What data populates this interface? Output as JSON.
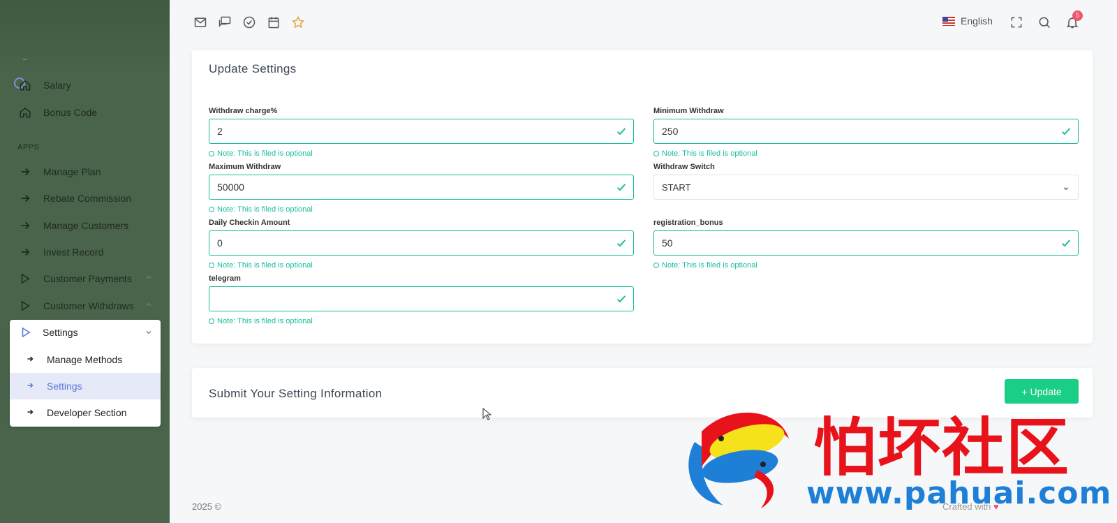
{
  "sidebar": {
    "items": [
      {
        "label": "Salary",
        "icon": "home-icon"
      },
      {
        "label": "Bonus Code",
        "icon": "home-icon"
      }
    ],
    "section_label": "APPS",
    "apps": [
      {
        "label": "Manage Plan",
        "icon": "arrow-right-icon"
      },
      {
        "label": "Rebate Commission",
        "icon": "arrow-right-icon"
      },
      {
        "label": "Manage Customers",
        "icon": "arrow-right-icon"
      },
      {
        "label": "Invest Record",
        "icon": "arrow-right-icon"
      },
      {
        "label": "Customer Payments",
        "icon": "play-icon"
      },
      {
        "label": "Customer Withdraws",
        "icon": "play-icon"
      }
    ],
    "settings_menu": {
      "label": "Settings",
      "items": [
        {
          "label": "Manage Methods",
          "active": false
        },
        {
          "label": "Settings",
          "active": true
        },
        {
          "label": "Developer Section",
          "active": false
        }
      ]
    }
  },
  "topbar": {
    "language": "English",
    "notification_count": "5"
  },
  "form": {
    "title": "Update Settings",
    "note_text": "Note: This is filed is optional",
    "withdraw_charge": {
      "label": "Withdraw charge%",
      "value": "2"
    },
    "minimum_withdraw": {
      "label": "Minimum Withdraw",
      "value": "250"
    },
    "maximum_withdraw": {
      "label": "Maximum Withdraw",
      "value": "50000"
    },
    "withdraw_switch": {
      "label": "Withdraw Switch",
      "value": "START"
    },
    "daily_checkin": {
      "label": "Daily Checkin Amount",
      "value": "0"
    },
    "registration_bonus": {
      "label": "registration_bonus",
      "value": "50"
    },
    "telegram": {
      "label": "telegram",
      "value": ""
    }
  },
  "submit": {
    "title": "Submit Your Setting Information",
    "button_label": "Update"
  },
  "footer": {
    "left": "2025 ©",
    "right": "Crafted with"
  },
  "watermark": {
    "chinese": "怕坏社区",
    "url": "www.pahuai.com"
  },
  "colors": {
    "sidebar_bg": "#4a644b",
    "accent_green": "#1abc9c",
    "button_green": "#1bce86",
    "active_blue": "#5a78d6",
    "badge_red": "#f1556c"
  }
}
